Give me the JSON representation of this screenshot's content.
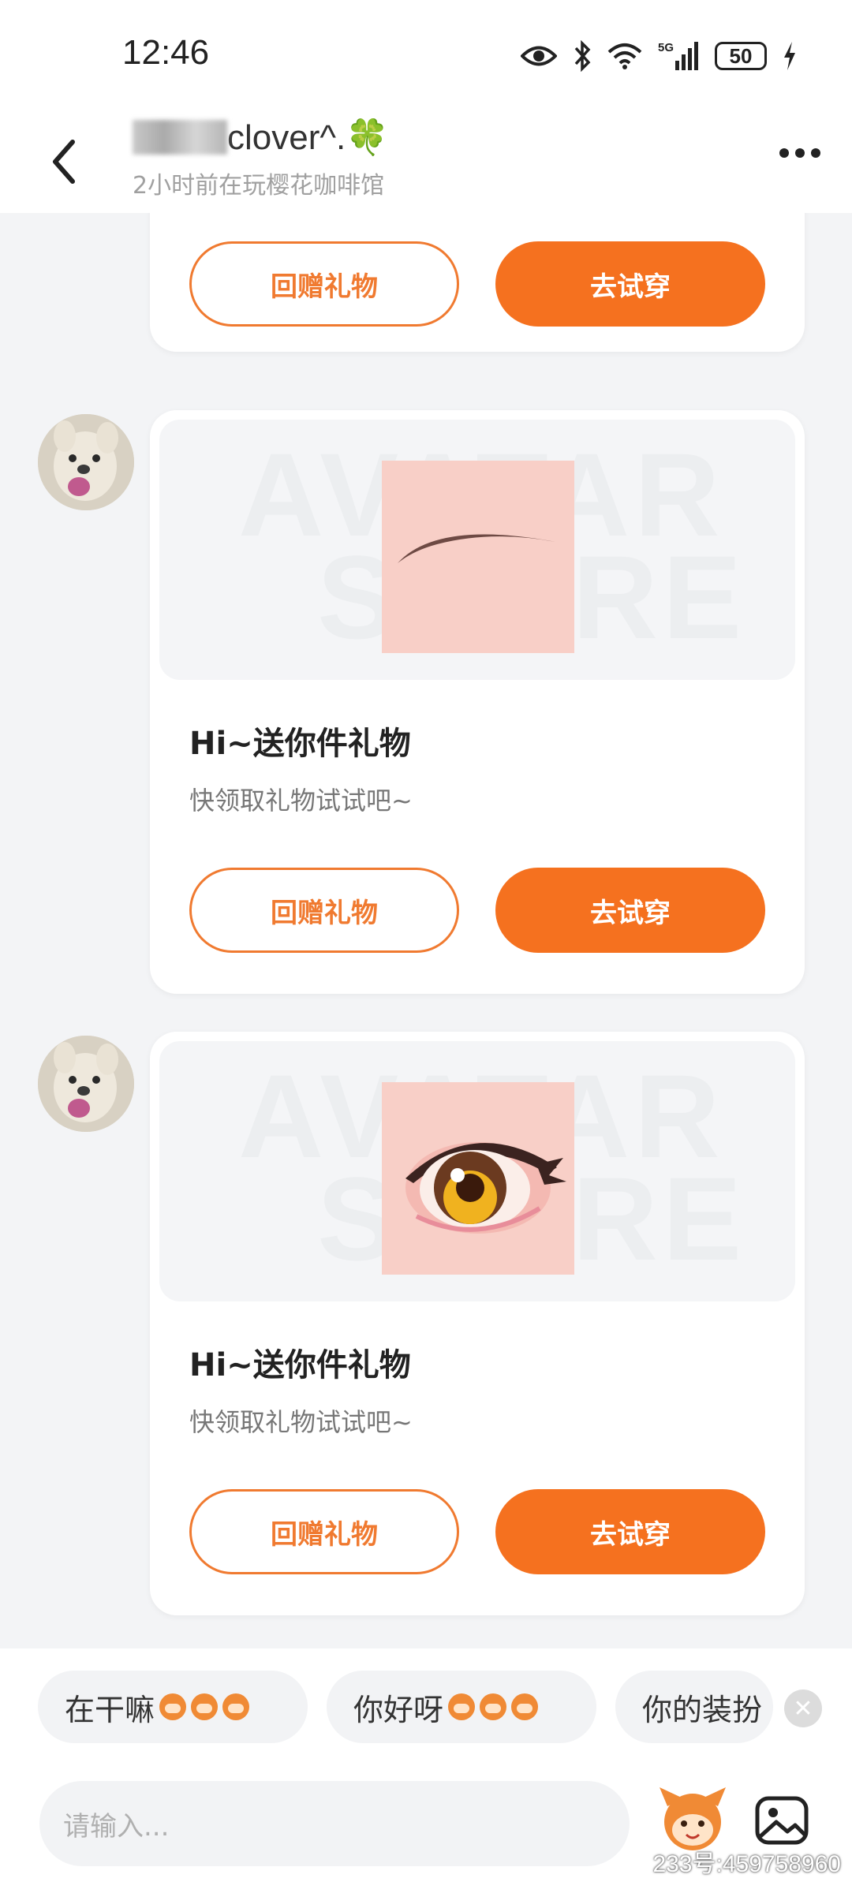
{
  "status_bar": {
    "time": "12:46",
    "battery": "50"
  },
  "header": {
    "name": "clover^.🍀",
    "substatus": "2小时前在玩樱花咖啡馆"
  },
  "cards": [
    {
      "return_gift_label": "回赠礼物",
      "try_on_label": "去试穿"
    },
    {
      "watermark_line1": "AVATAR",
      "watermark_line2": "STORE",
      "title": "Hi~送你件礼物",
      "subtitle": "快领取礼物试试吧~",
      "return_gift_label": "回赠礼物",
      "try_on_label": "去试穿"
    },
    {
      "watermark_line1": "AVATAR",
      "watermark_line2": "STORE",
      "title": "Hi~送你件礼物",
      "subtitle": "快领取礼物试试吧~",
      "return_gift_label": "回赠礼物",
      "try_on_label": "去试穿"
    }
  ],
  "quick_replies": [
    "在干嘛",
    "你好呀",
    "你的装扮"
  ],
  "input": {
    "placeholder": "请输入..."
  },
  "footer_id": "233号:459758960",
  "colors": {
    "accent": "#f5711f",
    "background": "#f3f4f6"
  }
}
